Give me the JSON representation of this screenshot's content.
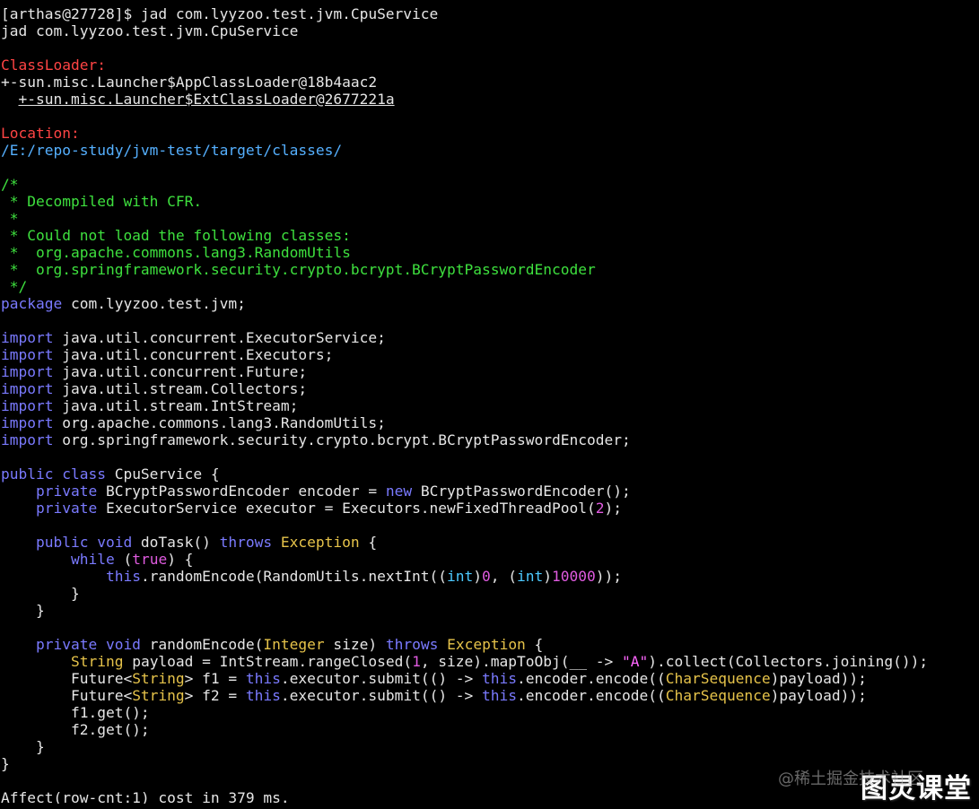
{
  "colors": {
    "default": "#e6e6e6",
    "label_red": "#ff4444",
    "path_blue": "#55b0ff",
    "comment_green": "#3ee03e",
    "keyword_blue": "#7a7aff",
    "type_gold": "#e6c34a",
    "number_magenta": "#e05be0",
    "string_magenta": "#ff66ff",
    "cast_cyan": "#4cc9ff"
  },
  "terminal": {
    "lines": [
      [
        {
          "t": "[arthas@27728]$ jad com.lyyzoo.test.jvm.CpuService",
          "c": "default"
        }
      ],
      [
        {
          "t": "jad com.lyyzoo.test.jvm.CpuService",
          "c": "default"
        }
      ],
      [],
      [
        {
          "t": "ClassLoader:",
          "c": "label_red"
        }
      ],
      [
        {
          "t": "+-sun.misc.Launcher$AppClassLoader@18b4aac2",
          "c": "default"
        }
      ],
      [
        {
          "t": "  ",
          "c": "default"
        },
        {
          "t": "+-sun.misc.Launcher$ExtClassLoader@2677221a",
          "c": "default",
          "u": true
        }
      ],
      [],
      [
        {
          "t": "Location:",
          "c": "label_red"
        }
      ],
      [
        {
          "t": "/E:/repo-study/jvm-test/target/classes/",
          "c": "path_blue"
        }
      ],
      [],
      [
        {
          "t": "/*",
          "c": "comment_green"
        }
      ],
      [
        {
          "t": " * Decompiled with CFR.",
          "c": "comment_green"
        }
      ],
      [
        {
          "t": " *",
          "c": "comment_green"
        }
      ],
      [
        {
          "t": " * Could not load the following classes:",
          "c": "comment_green"
        }
      ],
      [
        {
          "t": " *  org.apache.commons.lang3.RandomUtils",
          "c": "comment_green"
        }
      ],
      [
        {
          "t": " *  org.springframework.security.crypto.bcrypt.BCryptPasswordEncoder",
          "c": "comment_green"
        }
      ],
      [
        {
          "t": " */",
          "c": "comment_green"
        }
      ],
      [
        {
          "t": "package",
          "c": "keyword_blue"
        },
        {
          "t": " com.lyyzoo.test.jvm;",
          "c": "default"
        }
      ],
      [],
      [
        {
          "t": "import",
          "c": "keyword_blue"
        },
        {
          "t": " java.util.concurrent.ExecutorService;",
          "c": "default"
        }
      ],
      [
        {
          "t": "import",
          "c": "keyword_blue"
        },
        {
          "t": " java.util.concurrent.Executors;",
          "c": "default"
        }
      ],
      [
        {
          "t": "import",
          "c": "keyword_blue"
        },
        {
          "t": " java.util.concurrent.Future;",
          "c": "default"
        }
      ],
      [
        {
          "t": "import",
          "c": "keyword_blue"
        },
        {
          "t": " java.util.stream.Collectors;",
          "c": "default"
        }
      ],
      [
        {
          "t": "import",
          "c": "keyword_blue"
        },
        {
          "t": " java.util.stream.IntStream;",
          "c": "default"
        }
      ],
      [
        {
          "t": "import",
          "c": "keyword_blue"
        },
        {
          "t": " org.apache.commons.lang3.RandomUtils;",
          "c": "default"
        }
      ],
      [
        {
          "t": "import",
          "c": "keyword_blue"
        },
        {
          "t": " org.springframework.security.crypto.bcrypt.BCryptPasswordEncoder;",
          "c": "default"
        }
      ],
      [],
      [
        {
          "t": "public class",
          "c": "keyword_blue"
        },
        {
          "t": " CpuService {",
          "c": "default"
        }
      ],
      [
        {
          "t": "    ",
          "c": "default"
        },
        {
          "t": "private",
          "c": "keyword_blue"
        },
        {
          "t": " BCryptPasswordEncoder encoder = ",
          "c": "default"
        },
        {
          "t": "new",
          "c": "keyword_blue"
        },
        {
          "t": " BCryptPasswordEncoder();",
          "c": "default"
        }
      ],
      [
        {
          "t": "    ",
          "c": "default"
        },
        {
          "t": "private",
          "c": "keyword_blue"
        },
        {
          "t": " ExecutorService executor = Executors.newFixedThreadPool(",
          "c": "default"
        },
        {
          "t": "2",
          "c": "number_magenta"
        },
        {
          "t": ");",
          "c": "default"
        }
      ],
      [],
      [
        {
          "t": "    ",
          "c": "default"
        },
        {
          "t": "public void",
          "c": "keyword_blue"
        },
        {
          "t": " doTask() ",
          "c": "default"
        },
        {
          "t": "throws",
          "c": "keyword_blue"
        },
        {
          "t": " ",
          "c": "default"
        },
        {
          "t": "Exception",
          "c": "type_gold"
        },
        {
          "t": " {",
          "c": "default"
        }
      ],
      [
        {
          "t": "        ",
          "c": "default"
        },
        {
          "t": "while",
          "c": "keyword_blue"
        },
        {
          "t": " (",
          "c": "default"
        },
        {
          "t": "true",
          "c": "number_magenta"
        },
        {
          "t": ") {",
          "c": "default"
        }
      ],
      [
        {
          "t": "            ",
          "c": "default"
        },
        {
          "t": "this",
          "c": "keyword_blue"
        },
        {
          "t": ".randomEncode(RandomUtils.nextInt((",
          "c": "default"
        },
        {
          "t": "int",
          "c": "cast_cyan"
        },
        {
          "t": ")",
          "c": "default"
        },
        {
          "t": "0",
          "c": "number_magenta"
        },
        {
          "t": ", (",
          "c": "default"
        },
        {
          "t": "int",
          "c": "cast_cyan"
        },
        {
          "t": ")",
          "c": "default"
        },
        {
          "t": "10000",
          "c": "number_magenta"
        },
        {
          "t": "));",
          "c": "default"
        }
      ],
      [
        {
          "t": "        }",
          "c": "default"
        }
      ],
      [
        {
          "t": "    }",
          "c": "default"
        }
      ],
      [],
      [
        {
          "t": "    ",
          "c": "default"
        },
        {
          "t": "private void",
          "c": "keyword_blue"
        },
        {
          "t": " randomEncode(",
          "c": "default"
        },
        {
          "t": "Integer",
          "c": "type_gold"
        },
        {
          "t": " size) ",
          "c": "default"
        },
        {
          "t": "throws",
          "c": "keyword_blue"
        },
        {
          "t": " ",
          "c": "default"
        },
        {
          "t": "Exception",
          "c": "type_gold"
        },
        {
          "t": " {",
          "c": "default"
        }
      ],
      [
        {
          "t": "        ",
          "c": "default"
        },
        {
          "t": "String",
          "c": "type_gold"
        },
        {
          "t": " payload = IntStream.rangeClosed(",
          "c": "default"
        },
        {
          "t": "1",
          "c": "number_magenta"
        },
        {
          "t": ", size).mapToObj(__ -> ",
          "c": "default"
        },
        {
          "t": "\"A\"",
          "c": "string_magenta"
        },
        {
          "t": ").collect(Collectors.joining());",
          "c": "default"
        }
      ],
      [
        {
          "t": "        Future<",
          "c": "default"
        },
        {
          "t": "String",
          "c": "type_gold"
        },
        {
          "t": "> f1 = ",
          "c": "default"
        },
        {
          "t": "this",
          "c": "keyword_blue"
        },
        {
          "t": ".executor.submit(() -> ",
          "c": "default"
        },
        {
          "t": "this",
          "c": "keyword_blue"
        },
        {
          "t": ".encoder.encode((",
          "c": "default"
        },
        {
          "t": "CharSequence",
          "c": "type_gold"
        },
        {
          "t": ")payload));",
          "c": "default"
        }
      ],
      [
        {
          "t": "        Future<",
          "c": "default"
        },
        {
          "t": "String",
          "c": "type_gold"
        },
        {
          "t": "> f2 = ",
          "c": "default"
        },
        {
          "t": "this",
          "c": "keyword_blue"
        },
        {
          "t": ".executor.submit(() -> ",
          "c": "default"
        },
        {
          "t": "this",
          "c": "keyword_blue"
        },
        {
          "t": ".encoder.encode((",
          "c": "default"
        },
        {
          "t": "CharSequence",
          "c": "type_gold"
        },
        {
          "t": ")payload));",
          "c": "default"
        }
      ],
      [
        {
          "t": "        f1.get();",
          "c": "default"
        }
      ],
      [
        {
          "t": "        f2.get();",
          "c": "default"
        }
      ],
      [
        {
          "t": "    }",
          "c": "default"
        }
      ],
      [
        {
          "t": "}",
          "c": "default"
        }
      ],
      [],
      [
        {
          "t": "Affect(row-cnt:1) cost in 379 ms.",
          "c": "default"
        }
      ]
    ]
  },
  "watermark": {
    "small": "@稀土掘金技术社区",
    "large": "图灵课堂"
  }
}
